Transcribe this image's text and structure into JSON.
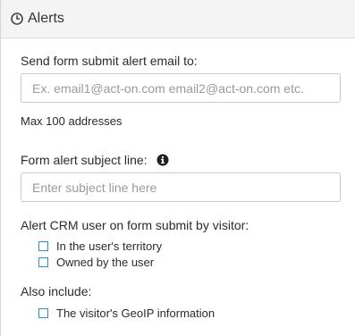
{
  "header": {
    "title": "Alerts",
    "icon": "clock-icon"
  },
  "email_alert": {
    "label": "Send form submit alert email to:",
    "placeholder": "Ex. email1@act-on.com email2@act-on.com etc.",
    "value": "",
    "hint": "Max 100 addresses"
  },
  "subject_line": {
    "label": "Form alert subject line:",
    "info_icon": "info-icon",
    "placeholder": "Enter subject line here",
    "value": ""
  },
  "crm_alert": {
    "label": "Alert CRM user on form submit by visitor:",
    "options": [
      {
        "label": "In the user's territory",
        "checked": false
      },
      {
        "label": "Owned by the user",
        "checked": false
      }
    ]
  },
  "also_include": {
    "label": "Also include:",
    "options": [
      {
        "label": "The visitor's GeoIP information",
        "checked": false
      }
    ]
  },
  "colors": {
    "checkbox_border": "#2a8fd4",
    "header_bg": "#f4f4f4"
  }
}
